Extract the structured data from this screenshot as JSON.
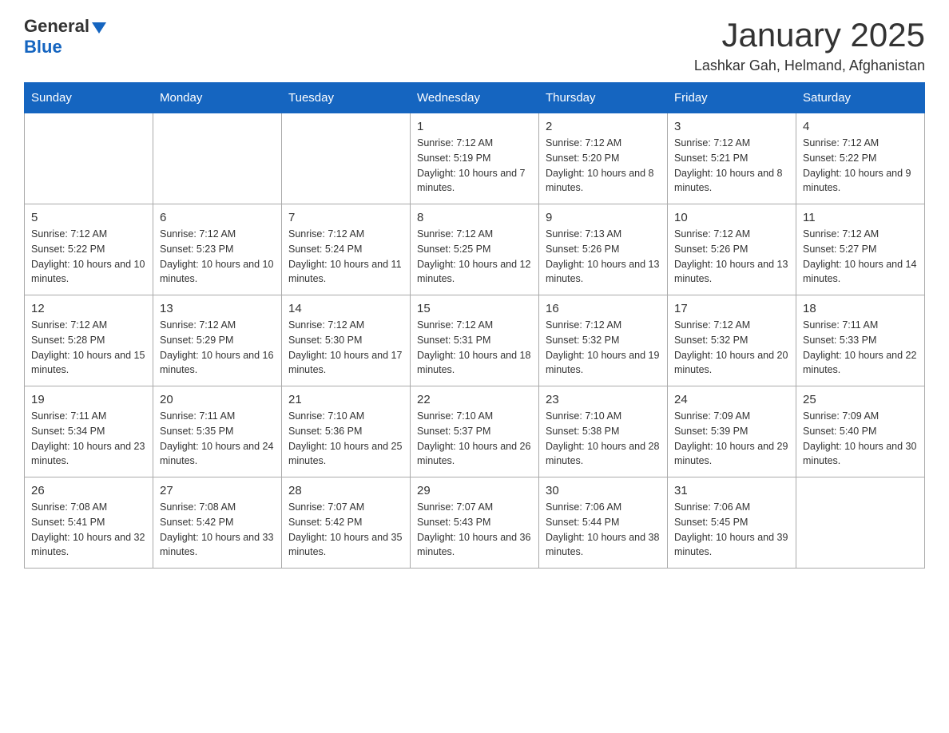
{
  "header": {
    "logo_general": "General",
    "logo_blue": "Blue",
    "title": "January 2025",
    "subtitle": "Lashkar Gah, Helmand, Afghanistan"
  },
  "weekdays": [
    "Sunday",
    "Monday",
    "Tuesday",
    "Wednesday",
    "Thursday",
    "Friday",
    "Saturday"
  ],
  "weeks": [
    [
      {
        "day": "",
        "info": ""
      },
      {
        "day": "",
        "info": ""
      },
      {
        "day": "",
        "info": ""
      },
      {
        "day": "1",
        "info": "Sunrise: 7:12 AM\nSunset: 5:19 PM\nDaylight: 10 hours and 7 minutes."
      },
      {
        "day": "2",
        "info": "Sunrise: 7:12 AM\nSunset: 5:20 PM\nDaylight: 10 hours and 8 minutes."
      },
      {
        "day": "3",
        "info": "Sunrise: 7:12 AM\nSunset: 5:21 PM\nDaylight: 10 hours and 8 minutes."
      },
      {
        "day": "4",
        "info": "Sunrise: 7:12 AM\nSunset: 5:22 PM\nDaylight: 10 hours and 9 minutes."
      }
    ],
    [
      {
        "day": "5",
        "info": "Sunrise: 7:12 AM\nSunset: 5:22 PM\nDaylight: 10 hours and 10 minutes."
      },
      {
        "day": "6",
        "info": "Sunrise: 7:12 AM\nSunset: 5:23 PM\nDaylight: 10 hours and 10 minutes."
      },
      {
        "day": "7",
        "info": "Sunrise: 7:12 AM\nSunset: 5:24 PM\nDaylight: 10 hours and 11 minutes."
      },
      {
        "day": "8",
        "info": "Sunrise: 7:12 AM\nSunset: 5:25 PM\nDaylight: 10 hours and 12 minutes."
      },
      {
        "day": "9",
        "info": "Sunrise: 7:13 AM\nSunset: 5:26 PM\nDaylight: 10 hours and 13 minutes."
      },
      {
        "day": "10",
        "info": "Sunrise: 7:12 AM\nSunset: 5:26 PM\nDaylight: 10 hours and 13 minutes."
      },
      {
        "day": "11",
        "info": "Sunrise: 7:12 AM\nSunset: 5:27 PM\nDaylight: 10 hours and 14 minutes."
      }
    ],
    [
      {
        "day": "12",
        "info": "Sunrise: 7:12 AM\nSunset: 5:28 PM\nDaylight: 10 hours and 15 minutes."
      },
      {
        "day": "13",
        "info": "Sunrise: 7:12 AM\nSunset: 5:29 PM\nDaylight: 10 hours and 16 minutes."
      },
      {
        "day": "14",
        "info": "Sunrise: 7:12 AM\nSunset: 5:30 PM\nDaylight: 10 hours and 17 minutes."
      },
      {
        "day": "15",
        "info": "Sunrise: 7:12 AM\nSunset: 5:31 PM\nDaylight: 10 hours and 18 minutes."
      },
      {
        "day": "16",
        "info": "Sunrise: 7:12 AM\nSunset: 5:32 PM\nDaylight: 10 hours and 19 minutes."
      },
      {
        "day": "17",
        "info": "Sunrise: 7:12 AM\nSunset: 5:32 PM\nDaylight: 10 hours and 20 minutes."
      },
      {
        "day": "18",
        "info": "Sunrise: 7:11 AM\nSunset: 5:33 PM\nDaylight: 10 hours and 22 minutes."
      }
    ],
    [
      {
        "day": "19",
        "info": "Sunrise: 7:11 AM\nSunset: 5:34 PM\nDaylight: 10 hours and 23 minutes."
      },
      {
        "day": "20",
        "info": "Sunrise: 7:11 AM\nSunset: 5:35 PM\nDaylight: 10 hours and 24 minutes."
      },
      {
        "day": "21",
        "info": "Sunrise: 7:10 AM\nSunset: 5:36 PM\nDaylight: 10 hours and 25 minutes."
      },
      {
        "day": "22",
        "info": "Sunrise: 7:10 AM\nSunset: 5:37 PM\nDaylight: 10 hours and 26 minutes."
      },
      {
        "day": "23",
        "info": "Sunrise: 7:10 AM\nSunset: 5:38 PM\nDaylight: 10 hours and 28 minutes."
      },
      {
        "day": "24",
        "info": "Sunrise: 7:09 AM\nSunset: 5:39 PM\nDaylight: 10 hours and 29 minutes."
      },
      {
        "day": "25",
        "info": "Sunrise: 7:09 AM\nSunset: 5:40 PM\nDaylight: 10 hours and 30 minutes."
      }
    ],
    [
      {
        "day": "26",
        "info": "Sunrise: 7:08 AM\nSunset: 5:41 PM\nDaylight: 10 hours and 32 minutes."
      },
      {
        "day": "27",
        "info": "Sunrise: 7:08 AM\nSunset: 5:42 PM\nDaylight: 10 hours and 33 minutes."
      },
      {
        "day": "28",
        "info": "Sunrise: 7:07 AM\nSunset: 5:42 PM\nDaylight: 10 hours and 35 minutes."
      },
      {
        "day": "29",
        "info": "Sunrise: 7:07 AM\nSunset: 5:43 PM\nDaylight: 10 hours and 36 minutes."
      },
      {
        "day": "30",
        "info": "Sunrise: 7:06 AM\nSunset: 5:44 PM\nDaylight: 10 hours and 38 minutes."
      },
      {
        "day": "31",
        "info": "Sunrise: 7:06 AM\nSunset: 5:45 PM\nDaylight: 10 hours and 39 minutes."
      },
      {
        "day": "",
        "info": ""
      }
    ]
  ]
}
